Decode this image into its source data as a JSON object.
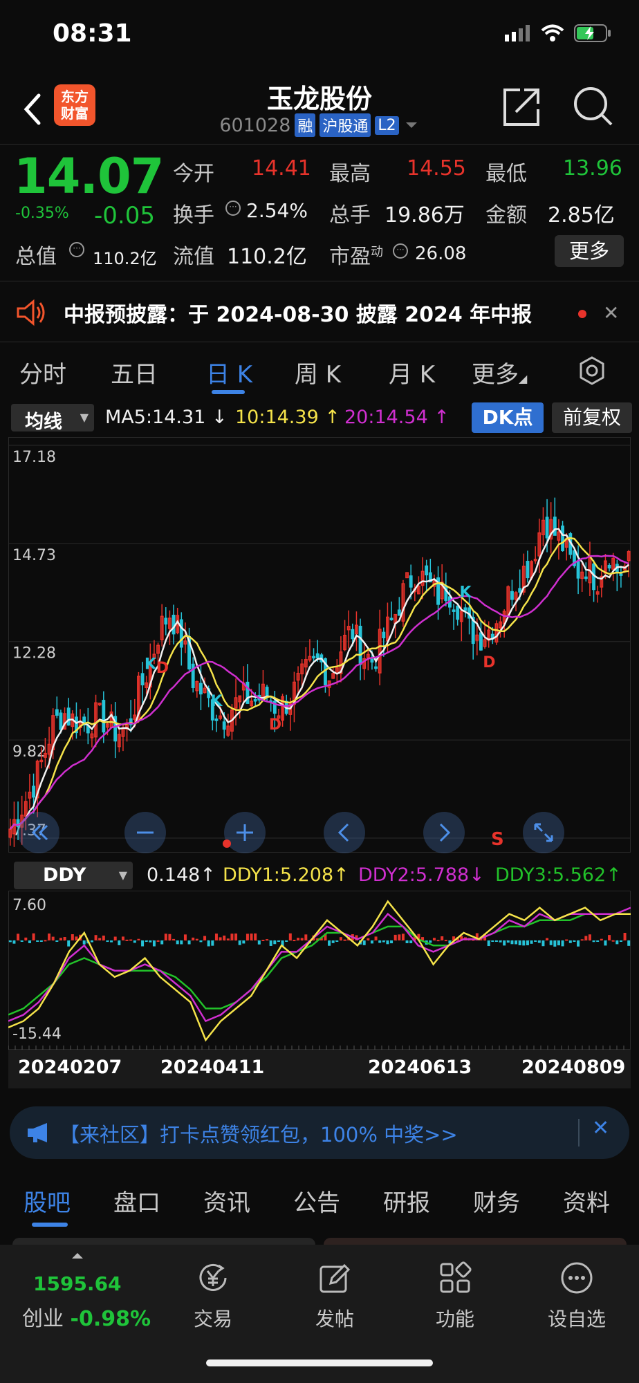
{
  "status_bar": {
    "time": "08:31"
  },
  "header": {
    "logo_line1": "东方",
    "logo_line2": "财富",
    "stock_name": "玉龙股份",
    "stock_code": "601028",
    "tags": [
      "融",
      "沪股通",
      "L2"
    ]
  },
  "quote": {
    "price": "14.07",
    "change_pct": "-0.35%",
    "change": "-0.05",
    "fields": [
      {
        "label": "今开",
        "value": "14.41",
        "color": "red"
      },
      {
        "label": "最高",
        "value": "14.55",
        "color": "red"
      },
      {
        "label": "最低",
        "value": "13.96",
        "color": "green"
      },
      {
        "label": "换手",
        "value": "2.54%",
        "color": "white"
      },
      {
        "label": "总手",
        "value": "19.86万",
        "color": "white"
      },
      {
        "label": "金额",
        "value": "2.85亿",
        "color": "white"
      },
      {
        "label": "总值",
        "value": "110.2亿",
        "color": "white"
      },
      {
        "label": "流值",
        "value": "110.2亿",
        "color": "white"
      },
      {
        "label": "市盈",
        "label_sup": "动",
        "value": "26.08",
        "color": "white"
      }
    ],
    "more_label": "更多"
  },
  "notice": {
    "text": "中报预披露：于 2024-08-30 披露 2024 年中报"
  },
  "chart_tabs": [
    {
      "label": "分时",
      "active": false
    },
    {
      "label": "五日",
      "active": false
    },
    {
      "label": "日 K",
      "active": true
    },
    {
      "label": "周 K",
      "active": false
    },
    {
      "label": "月 K",
      "active": false
    },
    {
      "label": "更多",
      "active": false
    }
  ],
  "ma_bar": {
    "selector": "均线",
    "ma5": "MA5:14.31",
    "ma10": "10:14.39",
    "ma20": "20:14.54",
    "dk_label": "DK点",
    "fq_label": "前复权"
  },
  "ddy_bar": {
    "selector": "DDY",
    "ddy": "0.148",
    "ddy1": "DDY1:5.208",
    "ddy2": "DDY2:5.788",
    "ddy3": "DDY3:5.562"
  },
  "colors": {
    "up": "#e8332b",
    "down": "#27c3d8",
    "ma5": "#f0f0f0",
    "ma10": "#f5e34a",
    "ma20": "#d02fd0",
    "ddy3": "#22c22a",
    "accent": "#3d83e6"
  },
  "chart_data": [
    {
      "type": "candlestick",
      "title": "日K",
      "y_ticks": [
        "17.18",
        "14.73",
        "12.28",
        "9.82",
        "7.37"
      ],
      "ylim": [
        7.37,
        17.18
      ],
      "x_labels": [
        "20240207",
        "20240411",
        "20240613",
        "20240809"
      ],
      "series": [
        {
          "name": "MA5",
          "last": 14.31
        },
        {
          "name": "10",
          "last": 14.39
        },
        {
          "name": "20",
          "last": 14.54
        }
      ],
      "close_path": [
        7.6,
        8.1,
        8.6,
        9.3,
        10.2,
        10.5,
        10.3,
        10.2,
        10.4,
        10.3,
        10.0,
        10.1,
        11.0,
        11.6,
        12.6,
        13.0,
        12.4,
        11.4,
        11.0,
        10.6,
        10.4,
        10.7,
        10.9,
        10.8,
        11.0,
        10.6,
        10.8,
        11.2,
        11.6,
        11.8,
        11.4,
        12.1,
        12.6,
        12.0,
        11.8,
        12.4,
        12.9,
        13.6,
        14.0,
        13.8,
        13.4,
        13.6,
        13.2,
        12.6,
        12.4,
        12.6,
        13.0,
        13.6,
        14.0,
        14.4,
        15.4,
        15.0,
        14.6,
        14.0,
        14.2,
        13.8,
        14.6,
        14.0,
        14.2
      ],
      "markers": [
        "K",
        "D",
        "K",
        "D",
        "K",
        "D",
        "S"
      ]
    },
    {
      "type": "line",
      "title": "DDY",
      "y_ticks": [
        "7.60",
        "-15.44"
      ],
      "ylim": [
        -15.44,
        7.6
      ],
      "series": [
        {
          "name": "DDY1",
          "last": 5.208
        },
        {
          "name": "DDY2",
          "last": 5.788
        },
        {
          "name": "DDY3",
          "last": 5.562
        }
      ],
      "ddy1_path": [
        -13,
        -12,
        -10,
        -6,
        -1,
        2,
        -3,
        -5,
        -4,
        -2,
        -5,
        -7,
        -9,
        -15,
        -12,
        -10,
        -8,
        -4,
        0,
        -2,
        1,
        4,
        2,
        0,
        3,
        7,
        4,
        1,
        -3,
        0,
        2,
        1,
        3,
        5,
        4,
        6,
        4,
        5,
        6,
        4,
        5,
        5
      ],
      "ddy2_path": [
        -12,
        -11,
        -9,
        -6,
        -2,
        0,
        -3,
        -4,
        -4,
        -3,
        -4,
        -6,
        -8,
        -12,
        -11,
        -9,
        -7,
        -4,
        -1,
        -1,
        1,
        3,
        2,
        1,
        2,
        5,
        3,
        0,
        -1,
        0,
        1,
        1,
        2,
        4,
        3,
        5,
        4,
        5,
        5,
        5,
        5,
        6
      ],
      "ddy3_path": [
        -11,
        -10,
        -8,
        -6,
        -3,
        -2,
        -3,
        -4,
        -4,
        -4,
        -4,
        -5,
        -7,
        -10,
        -10,
        -9,
        -7,
        -5,
        -2,
        -1,
        0,
        2,
        2,
        1,
        2,
        3,
        3,
        1,
        0,
        0,
        1,
        1,
        2,
        3,
        3,
        4,
        4,
        4,
        5,
        5,
        5,
        5
      ]
    }
  ],
  "banner": {
    "text": "【来社区】打卡点赞领红包，100% 中奖>>"
  },
  "info_tabs": [
    {
      "label": "股吧",
      "active": true
    },
    {
      "label": "盘口",
      "active": false
    },
    {
      "label": "资讯",
      "active": false
    },
    {
      "label": "公告",
      "active": false
    },
    {
      "label": "研报",
      "active": false
    },
    {
      "label": "财务",
      "active": false
    },
    {
      "label": "资料",
      "active": false
    }
  ],
  "bottom_nav": {
    "index_value": "1595.64",
    "index_name": "创业",
    "index_change": "-0.98%",
    "items": [
      {
        "label": "交易",
        "icon": "yuan-icon"
      },
      {
        "label": "发帖",
        "icon": "edit-icon"
      },
      {
        "label": "功能",
        "icon": "grid-icon"
      },
      {
        "label": "设自选",
        "icon": "more-icon"
      }
    ]
  }
}
